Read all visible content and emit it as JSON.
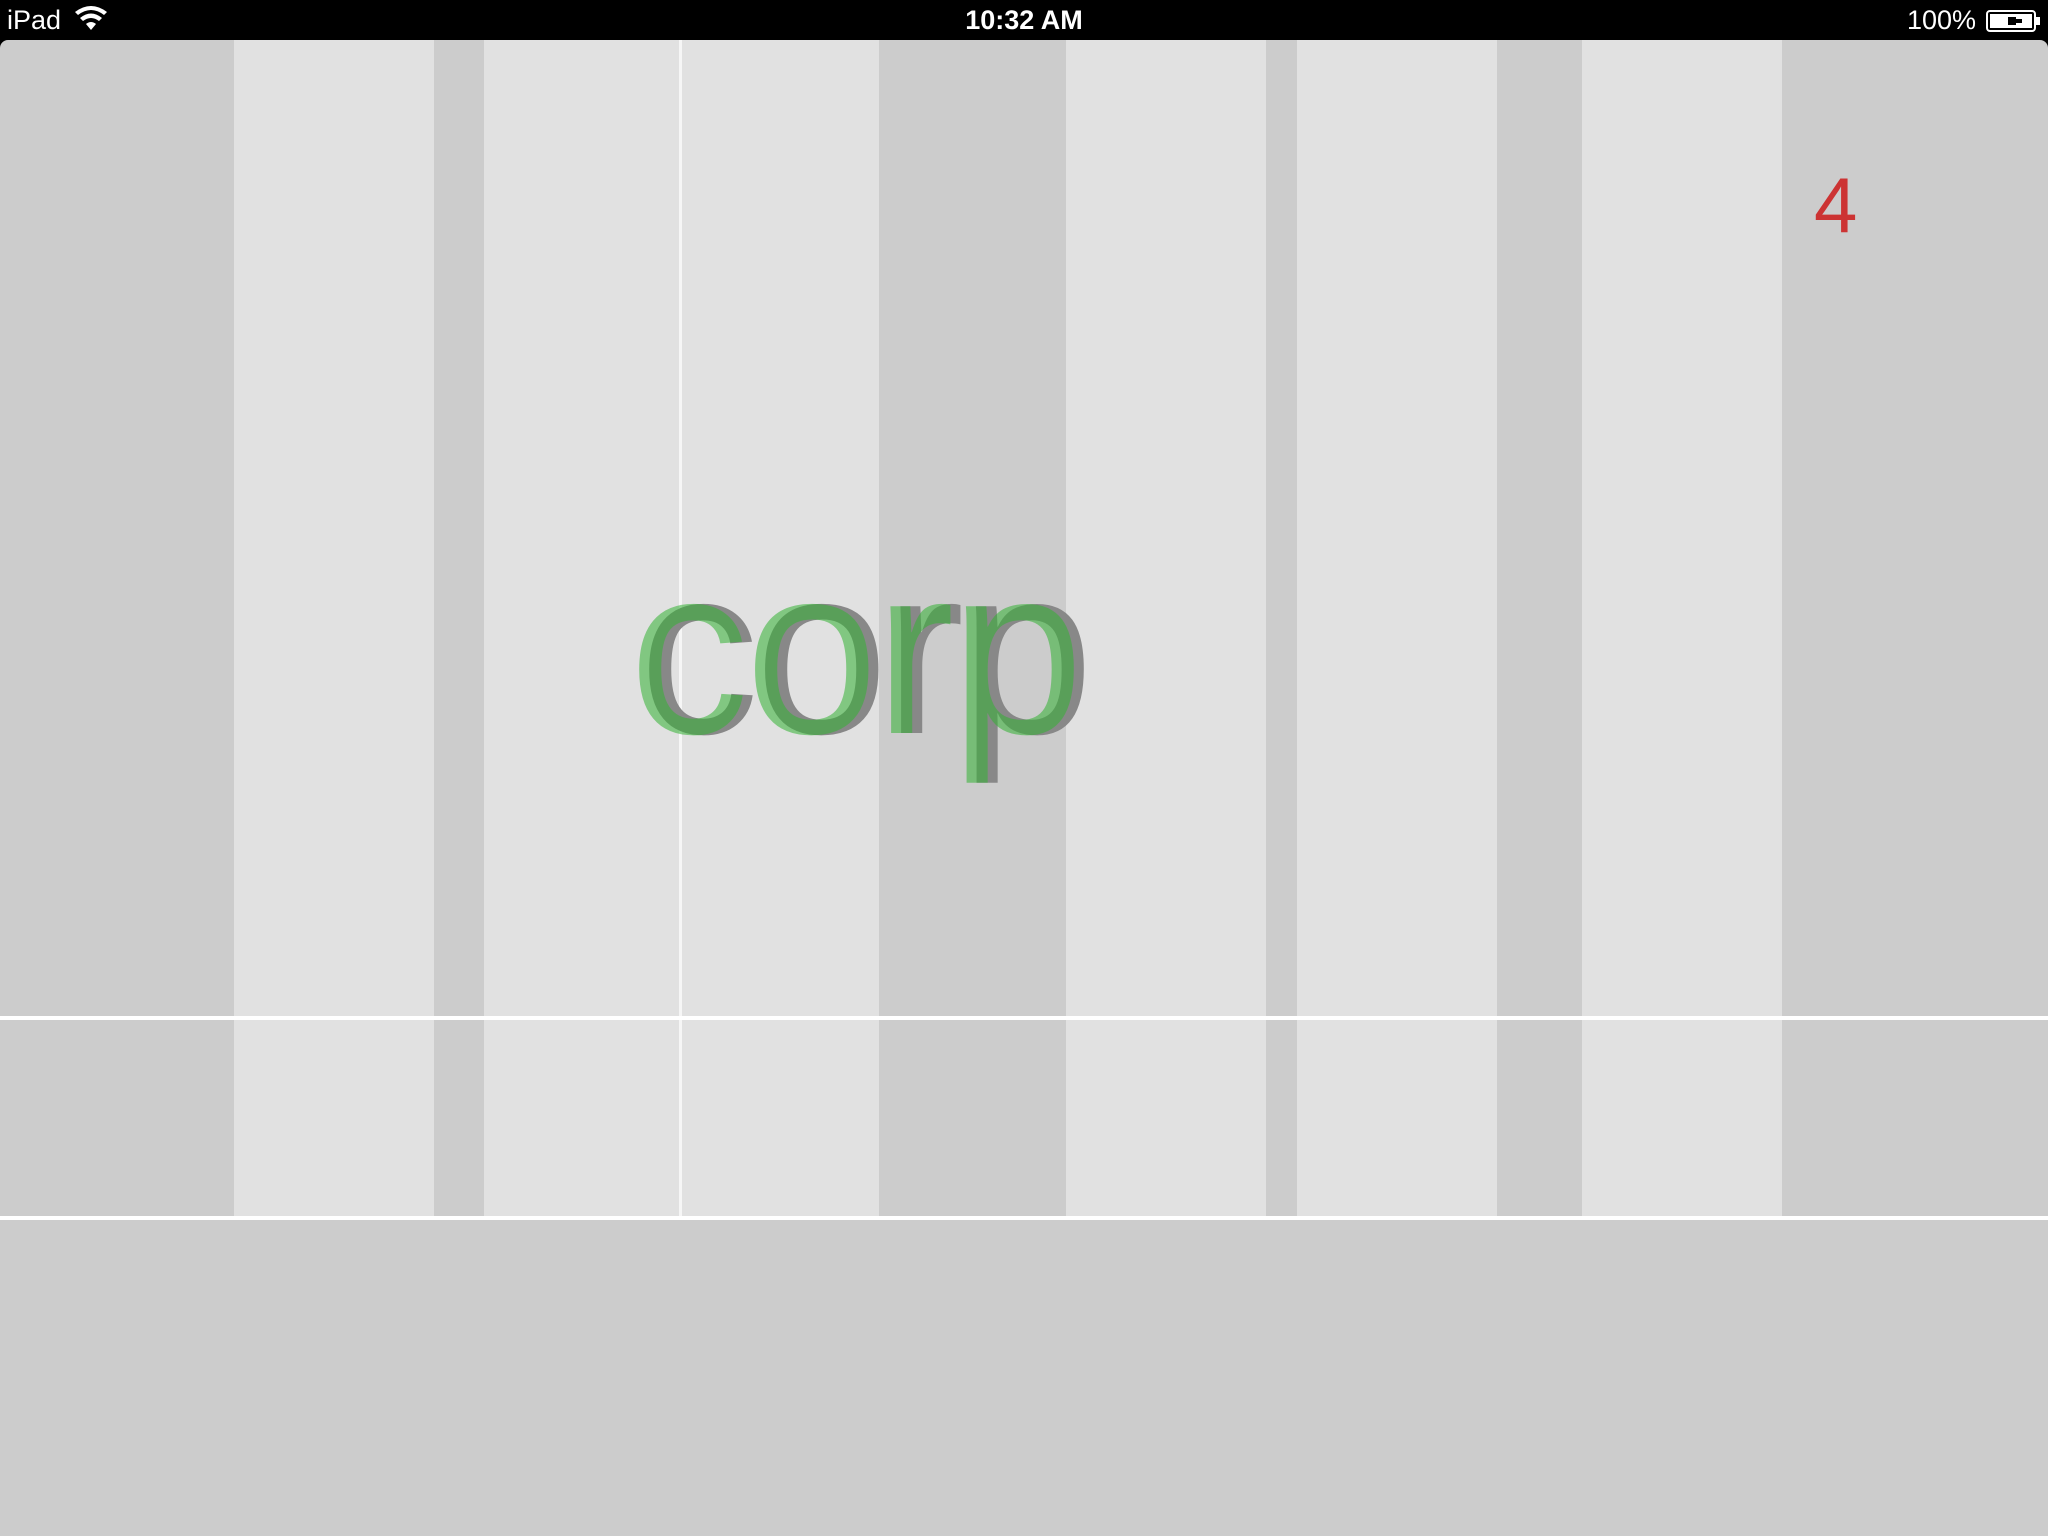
{
  "status_bar": {
    "device": "iPad",
    "time": "10:32 AM",
    "battery": "100%"
  },
  "game": {
    "word": "corp",
    "score": "4",
    "colors": {
      "background": "#cccccc",
      "column": "#e1e1e1",
      "word": "#33b233",
      "score": "#cc3333",
      "divider": "#ffffff"
    }
  }
}
